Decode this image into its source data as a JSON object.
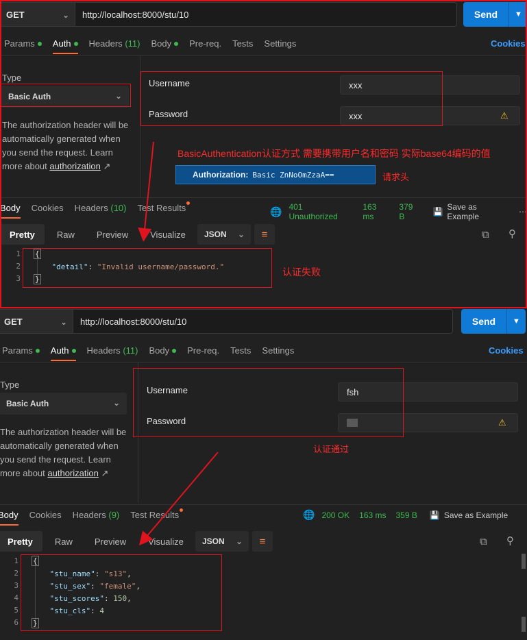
{
  "request1": {
    "method": "GET",
    "url": "http://localhost:8000/stu/10",
    "send_label": "Send",
    "tabs": [
      {
        "label": "Params",
        "dot": true
      },
      {
        "label": "Auth",
        "dot": true,
        "active": true
      },
      {
        "label": "Headers",
        "count": "(11)"
      },
      {
        "label": "Body",
        "dot": true
      },
      {
        "label": "Pre-req."
      },
      {
        "label": "Tests"
      },
      {
        "label": "Settings"
      }
    ],
    "cookies_label": "Cookies",
    "type_label": "Type",
    "auth_type": "Basic Auth",
    "description_lines": [
      "The authorization header will be",
      "automatically generated when",
      "you send the request. Learn"
    ],
    "description_more": "more about",
    "description_link": "authorization",
    "username_label": "Username",
    "username_value": "xxx",
    "password_label": "Password",
    "password_value": "xxx",
    "annotation": "BasicAuthentication认证方式 需要携带用户名和密码 实际base64编码的值",
    "header_banner_key": "Authorization:",
    "header_banner_value": "Basic ZnNoOmZzaA==",
    "header_note": "请求头",
    "response_tabs": [
      {
        "label": "Body",
        "active": true
      },
      {
        "label": "Cookies"
      },
      {
        "label": "Headers",
        "count": "(10)"
      },
      {
        "label": "Test Results",
        "odot": true
      }
    ],
    "status": "401 Unauthorized",
    "time": "163 ms",
    "size": "379 B",
    "save_example": "Save as Example",
    "view_tabs": [
      "Pretty",
      "Raw",
      "Preview",
      "Visualize"
    ],
    "format": "JSON",
    "code_lines": [
      "{",
      "    \"detail\": \"Invalid username/password.\"",
      "}"
    ],
    "result_note": "认证失败"
  },
  "request2": {
    "method": "GET",
    "url": "http://localhost:8000/stu/10",
    "send_label": "Send",
    "tabs": [
      {
        "label": "Params",
        "dot": true
      },
      {
        "label": "Auth",
        "dot": true,
        "active": true
      },
      {
        "label": "Headers",
        "count": "(11)"
      },
      {
        "label": "Body",
        "dot": true
      },
      {
        "label": "Pre-req."
      },
      {
        "label": "Tests"
      },
      {
        "label": "Settings"
      }
    ],
    "cookies_label": "Cookies",
    "type_label": "Type",
    "auth_type": "Basic Auth",
    "description_lines": [
      "The authorization header will be",
      "automatically generated when",
      "you send the request. Learn"
    ],
    "description_more": "more about",
    "description_link": "authorization",
    "username_label": "Username",
    "username_value": "fsh",
    "password_label": "Password",
    "result_note": "认证通过",
    "response_tabs": [
      {
        "label": "Body",
        "active": true
      },
      {
        "label": "Cookies"
      },
      {
        "label": "Headers",
        "count": "(9)"
      },
      {
        "label": "Test Results",
        "odot": true
      }
    ],
    "status": "200 OK",
    "time": "163 ms",
    "size": "359 B",
    "save_example": "Save as Example",
    "view_tabs": [
      "Pretty",
      "Raw",
      "Preview",
      "Visualize"
    ],
    "format": "JSON",
    "code_lines": [
      "{",
      "    \"stu_name\": \"s13\",",
      "    \"stu_sex\": \"female\",",
      "    \"stu_scores\": 150,",
      "    \"stu_cls\": 4",
      "}"
    ]
  },
  "icons": {
    "chevron": "chevron-down-icon",
    "globe": "globe-icon",
    "save": "save-icon",
    "copy": "copy-icon",
    "search": "search-icon",
    "warning": "warning-icon",
    "wrap": "wrap-lines-icon"
  },
  "colors": {
    "accent": "#ff6c37",
    "send": "#0f7bd6",
    "success": "#3fb950",
    "annotation": "#e0141e"
  }
}
